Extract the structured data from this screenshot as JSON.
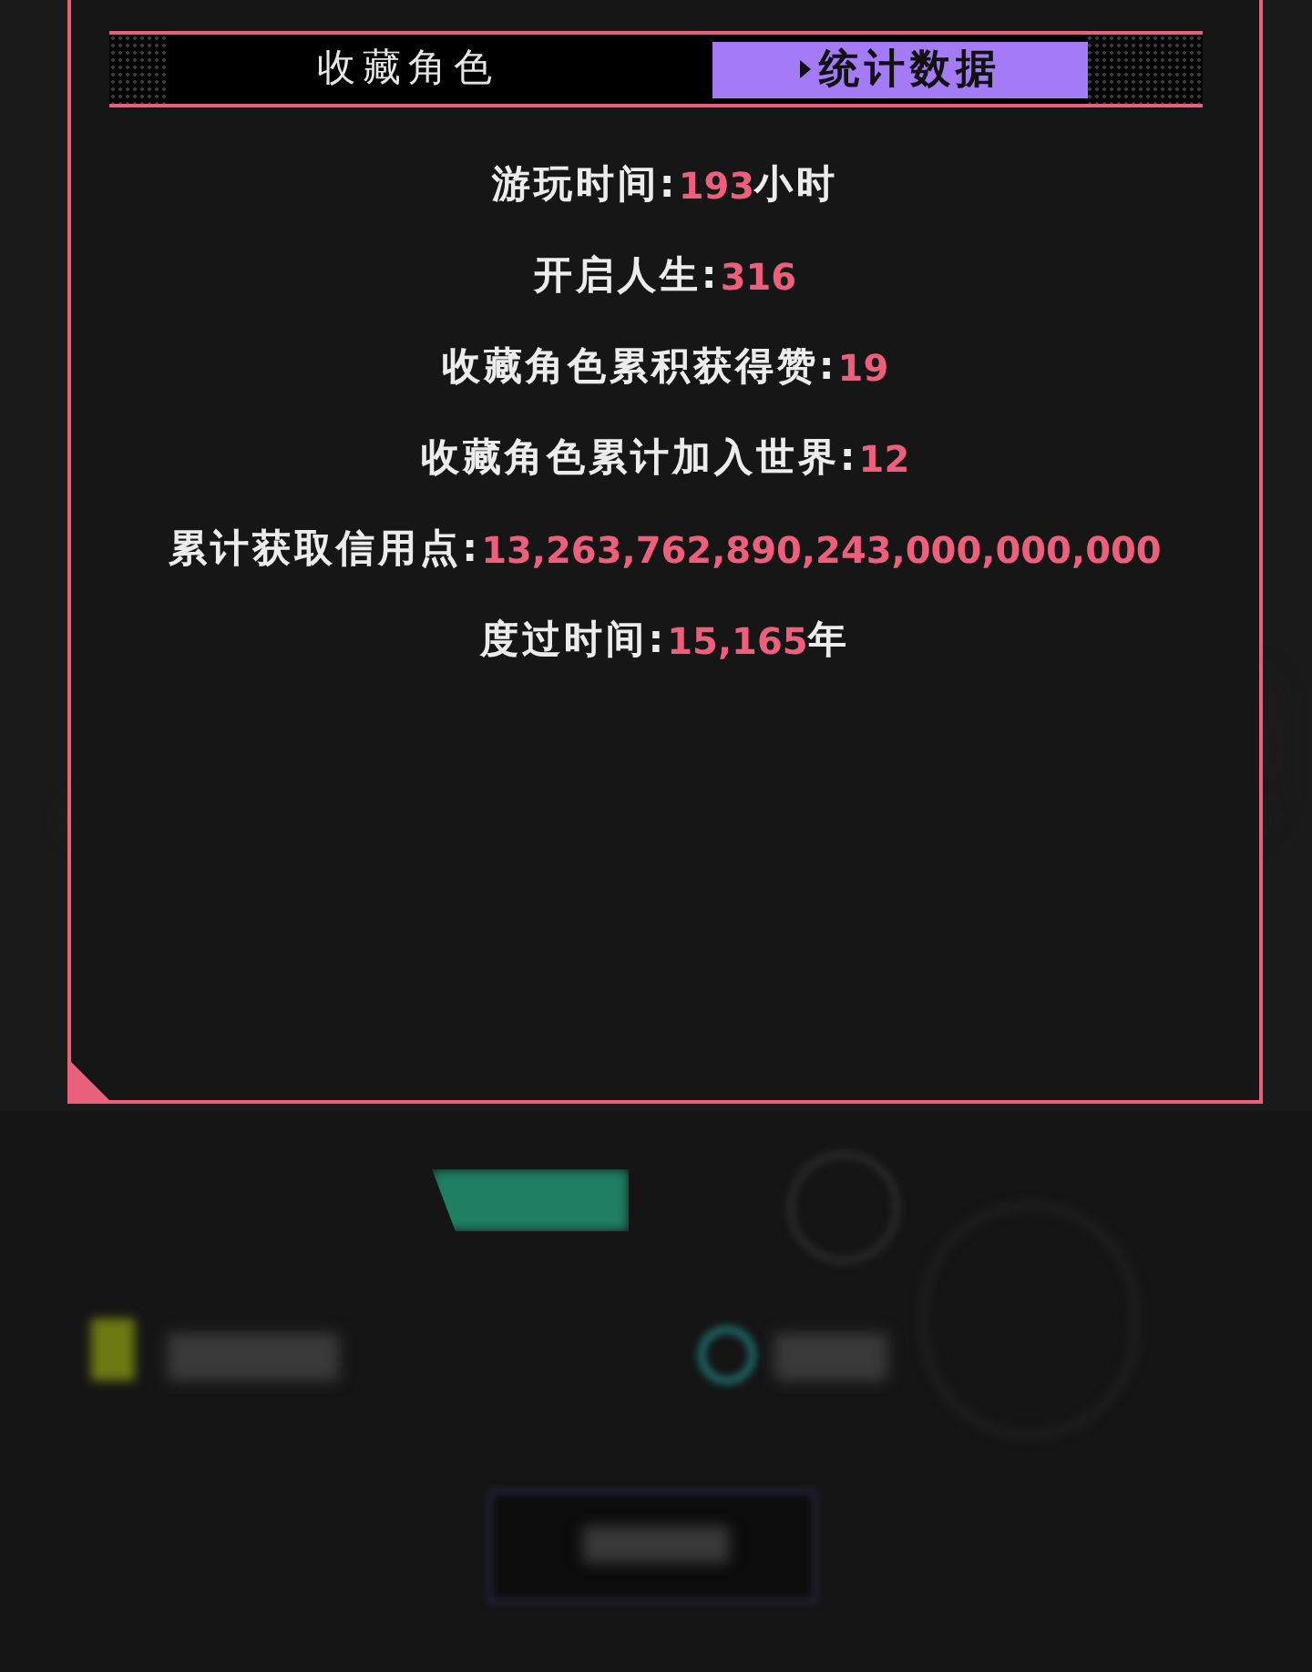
{
  "tabs": [
    {
      "label": "收藏角色",
      "selected": false
    },
    {
      "label": "统计数据",
      "selected": true
    }
  ],
  "stats": [
    {
      "label": "游玩时间:",
      "value": "193",
      "unit": "小时"
    },
    {
      "label": "开启人生:",
      "value": "316"
    },
    {
      "label": "收藏角色累积获得赞:",
      "value": "19"
    },
    {
      "label": "收藏角色累计加入世界:",
      "value": "12"
    },
    {
      "label": "累计获取信用点:",
      "value": "13,263,762,890,243,000,000,000"
    },
    {
      "label": "度过时间:",
      "value": "15,165",
      "unit": "年"
    }
  ]
}
